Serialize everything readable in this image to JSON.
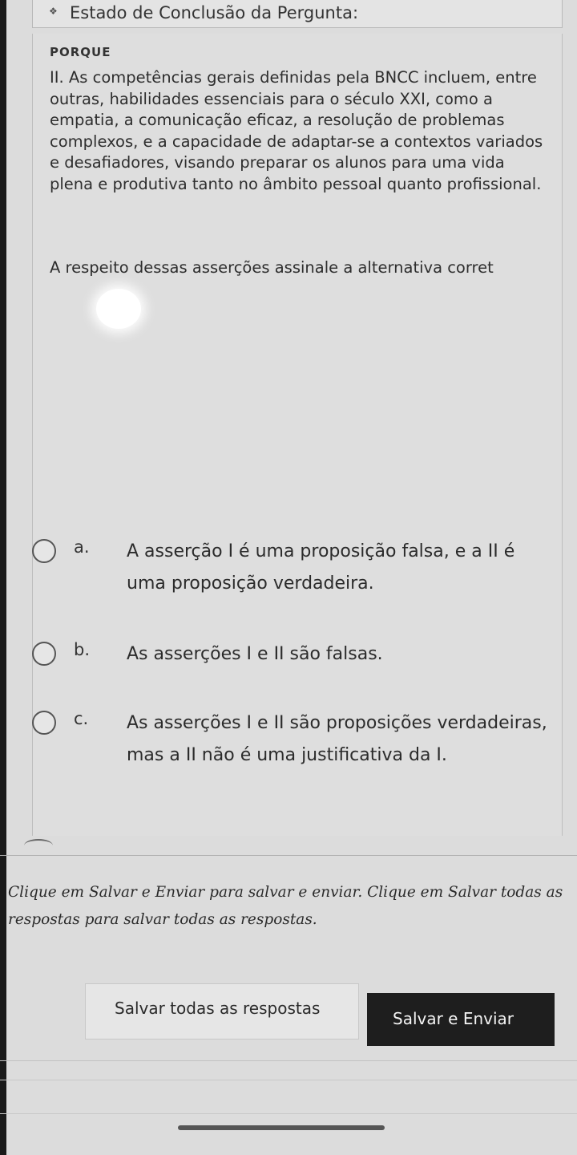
{
  "header": {
    "status_icon": "diamond-icon",
    "status_label": "Estado de Conclusão da Pergunta:"
  },
  "question": {
    "connector": "PORQUE",
    "assertion_ii": "II. As competências gerais definidas pela BNCC incluem, entre outras, habilidades essenciais para o século XXI, como a empatia, a comunicação eficaz, a resolução de problemas complexos, e a capacidade de adaptar-se a contextos variados e desafiadores, visando preparar os alunos para uma vida plena e produtiva tanto no âmbito pessoal quanto profissional.",
    "prompt": "A respeito dessas asserções assinale a alternativa corret"
  },
  "options": [
    {
      "letter": "a.",
      "text": "A asserção I é uma proposição falsa, e a II é uma proposição verdadeira.",
      "selected": false
    },
    {
      "letter": "b.",
      "text": "As asserções I e II são falsas.",
      "selected": false
    },
    {
      "letter": "c.",
      "text": "As asserções I e II são proposições verdadeiras, mas a II não é uma justificativa da I.",
      "selected": false
    }
  ],
  "footer": {
    "instructions": "Clique em Salvar e Enviar para salvar e enviar. Clique em Salvar todas as respostas para salvar todas as respostas.",
    "save_all_label": "Salvar todas as respostas",
    "submit_label": "Salvar e Enviar"
  }
}
